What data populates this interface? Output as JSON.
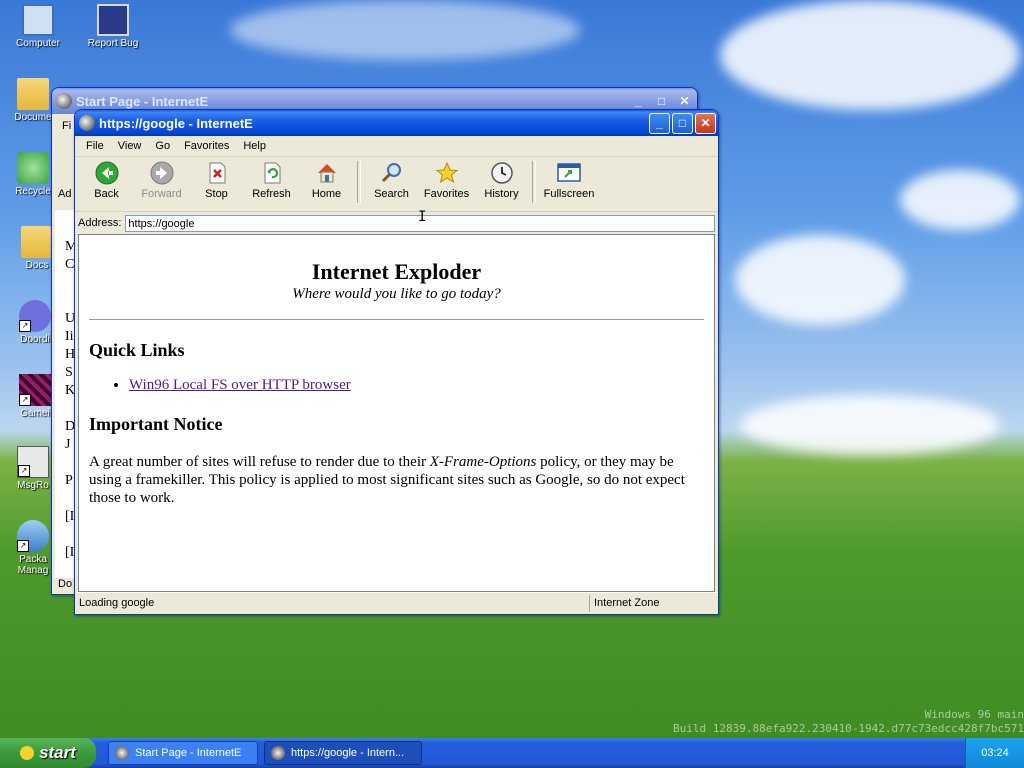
{
  "desktop": {
    "icons": [
      {
        "label": "Computer",
        "icon": "computer-icon"
      },
      {
        "label": "Report Bug",
        "icon": "report-bug-icon"
      },
      {
        "label": "Docume",
        "icon": "folder-icon"
      },
      {
        "label": "Recycle",
        "icon": "recycle-bin-icon"
      },
      {
        "label": "Docs",
        "icon": "folder-icon"
      },
      {
        "label": "Doordi",
        "icon": "discord-icon"
      },
      {
        "label": "Gamei",
        "icon": "game-icon"
      },
      {
        "label": "MsgRo",
        "icon": "msgroom-icon"
      },
      {
        "label": "Packa Manag",
        "icon": "package-manager-icon"
      }
    ],
    "watermark_line1": "Windows 96 main",
    "watermark_line2": "Build 12839.88efa922.230410-1942.d77c73edcc428f7bc571"
  },
  "back_window": {
    "title": "Start Page - InternetE",
    "menu_first": "Fi",
    "addr_label": "Ad",
    "peek_lines": [
      "M",
      "C",
      "U",
      "Ii",
      "H",
      "S",
      "K",
      "D",
      "J",
      "P",
      "[I",
      "[I"
    ],
    "status": "Do"
  },
  "window": {
    "title": "https://google - InternetE",
    "menu": [
      "File",
      "View",
      "Go",
      "Favorites",
      "Help"
    ],
    "toolbar": {
      "back": "Back",
      "forward": "Forward",
      "stop": "Stop",
      "refresh": "Refresh",
      "home": "Home",
      "search": "Search",
      "favorites": "Favorites",
      "history": "History",
      "fullscreen": "Fullscreen"
    },
    "address_label": "Address:",
    "address_value": "https://google",
    "status_left": "Loading google",
    "status_zone": "Internet Zone"
  },
  "page": {
    "title": "Internet Exploder",
    "tagline": "Where would you like to go today?",
    "quick_links_heading": "Quick Links",
    "quick_links": [
      "Win96 Local FS over HTTP browser"
    ],
    "notice_heading": "Important Notice",
    "notice_before": "A great number of sites will refuse to render due to their ",
    "notice_em": "X-Frame-Options",
    "notice_after": " policy, or they may be using a framekiller. This policy is applied to most significant sites such as Google, so do not expect those to work."
  },
  "taskbar": {
    "start_label": "start",
    "tasks": [
      "Start Page - InternetE",
      "https://google - Intern..."
    ],
    "clock": "03:24"
  },
  "colors": {
    "titlebar_active": "#0048d8",
    "start_button": "#3c9a3c",
    "taskbar": "#245edb",
    "link": "#551a8b"
  }
}
